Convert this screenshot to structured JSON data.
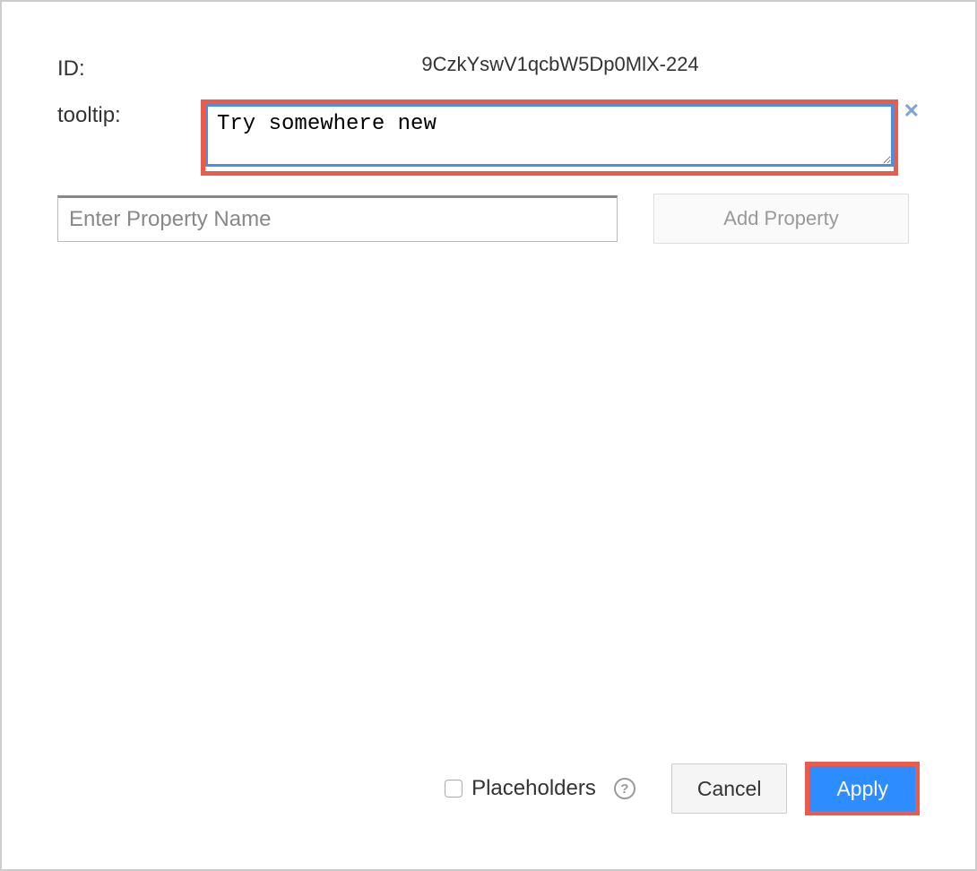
{
  "fields": {
    "id_label": "ID:",
    "id_value": "9CzkYswV1qcbW5Dp0MlX-224",
    "tooltip_label": "tooltip:",
    "tooltip_value": "Try somewhere new"
  },
  "property": {
    "placeholder": "Enter Property Name",
    "add_button": "Add Property"
  },
  "footer": {
    "placeholders_label": "Placeholders",
    "help_symbol": "?",
    "cancel_label": "Cancel",
    "apply_label": "Apply"
  }
}
